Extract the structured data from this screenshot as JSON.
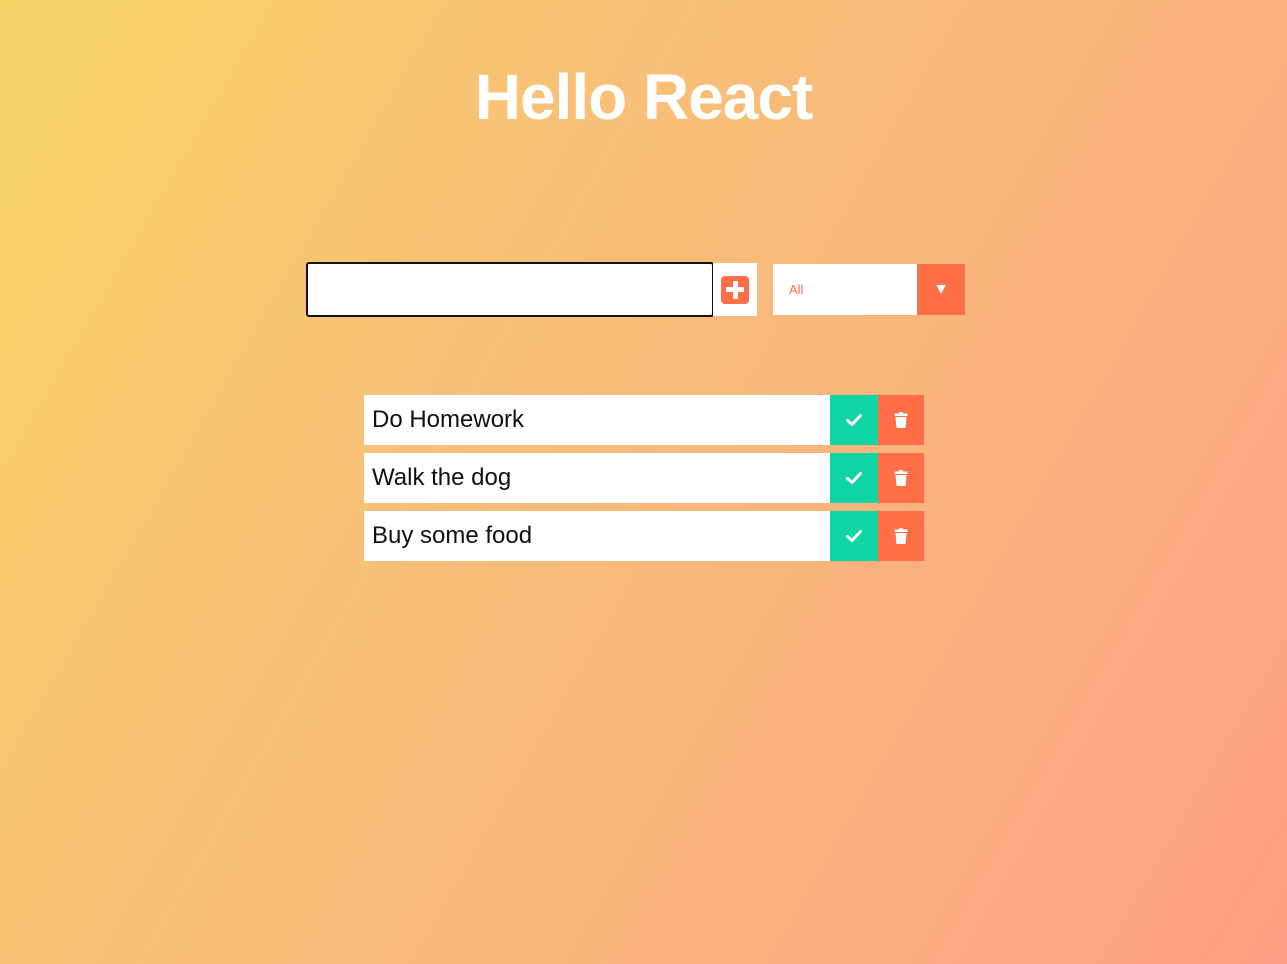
{
  "header": {
    "title": "Hello React"
  },
  "form": {
    "input_value": "",
    "add_icon": "plus-square-icon",
    "filter": {
      "selected": "All",
      "arrow_icon": "triangle-down-icon"
    }
  },
  "todos": [
    {
      "text": "Do Homework"
    },
    {
      "text": "Walk the dog"
    },
    {
      "text": "Buy some food"
    }
  ],
  "icons": {
    "complete": "check-icon",
    "delete": "trash-icon"
  },
  "colors": {
    "accent": "#ff6f47",
    "complete": "#0fd4a5",
    "gradient_start": "#f6d365",
    "gradient_end": "#fda085"
  }
}
